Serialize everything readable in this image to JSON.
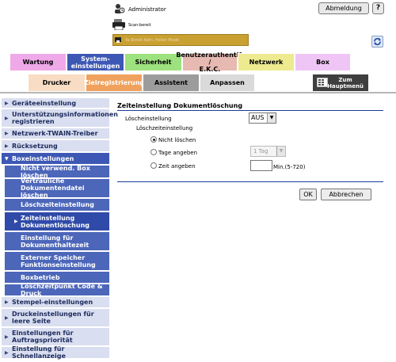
{
  "header": {
    "user": "Administrator",
    "logout_label": "Abmeldung",
    "help_label": "?",
    "status": "Scan-bereit",
    "marquee_text": "Ya Bereit Adm. Heller Mode"
  },
  "main_tabs": [
    {
      "label": "Wartung"
    },
    {
      "label": "System-\neinstellungen"
    },
    {
      "label": "Sicherheit"
    },
    {
      "label": "Benutzerauthentif. /\nE.K.C."
    },
    {
      "label": "Netzwerk"
    },
    {
      "label": "Box"
    }
  ],
  "sub_tabs": [
    {
      "label": "Drucker"
    },
    {
      "label": "Zielregistrierung"
    },
    {
      "label": "Assistent"
    },
    {
      "label": "Anpassen"
    },
    {
      "label": "Zum\nHauptmenü"
    }
  ],
  "sidebar": {
    "items": [
      {
        "label": "Geräteeinstellung"
      },
      {
        "label": "Unterstützungsinformationen registrieren"
      },
      {
        "label": "Netzwerk-TWAIN-Treiber"
      },
      {
        "label": "Rücksetzung"
      },
      {
        "label": "Boxeinstellungen"
      },
      {
        "label": "Stempel-einstellungen"
      },
      {
        "label": "Druckeinstellungen für leere Seite"
      },
      {
        "label": "Einstellungen für Auftragspriorität"
      },
      {
        "label": "Einstellung für Schnellanzeige"
      }
    ],
    "sub_items": [
      {
        "label": "Nicht verwend. Box löschen"
      },
      {
        "label": "Vertrauliche Dokumentendatei löschen"
      },
      {
        "label": "Löschzeiteinstellung"
      },
      {
        "label": "Zeiteinstellung Dokumentlöschung"
      },
      {
        "label": "Einstellung für Dokumenthaltezeit"
      },
      {
        "label": "Externer Speicher Funktionseinstellung"
      },
      {
        "label": "Boxbetrieb"
      },
      {
        "label": "Löschzeitpunkt Code & Druck"
      }
    ]
  },
  "content": {
    "title": "Zeiteinstellung Dokumentlöschung",
    "loesch_label": "Löscheinstellung",
    "loesch_value": "AUS",
    "zeit_label": "Löschzeiteinstellung",
    "options": [
      {
        "label": "Nicht löschen"
      },
      {
        "label": "Tage angeben"
      },
      {
        "label": "Zeit angeben"
      }
    ],
    "tage_value": "1 Tag",
    "min_input_value": "",
    "min_suffix": "Min.(5-720)",
    "ok_label": "OK",
    "abbrechen_label": "Abbrechen"
  },
  "colors": {
    "active_tab": "#3d58b4",
    "sidebar_bg": "#d9def0",
    "content_line": "#1a3d99",
    "marquee": "#c9a032"
  }
}
